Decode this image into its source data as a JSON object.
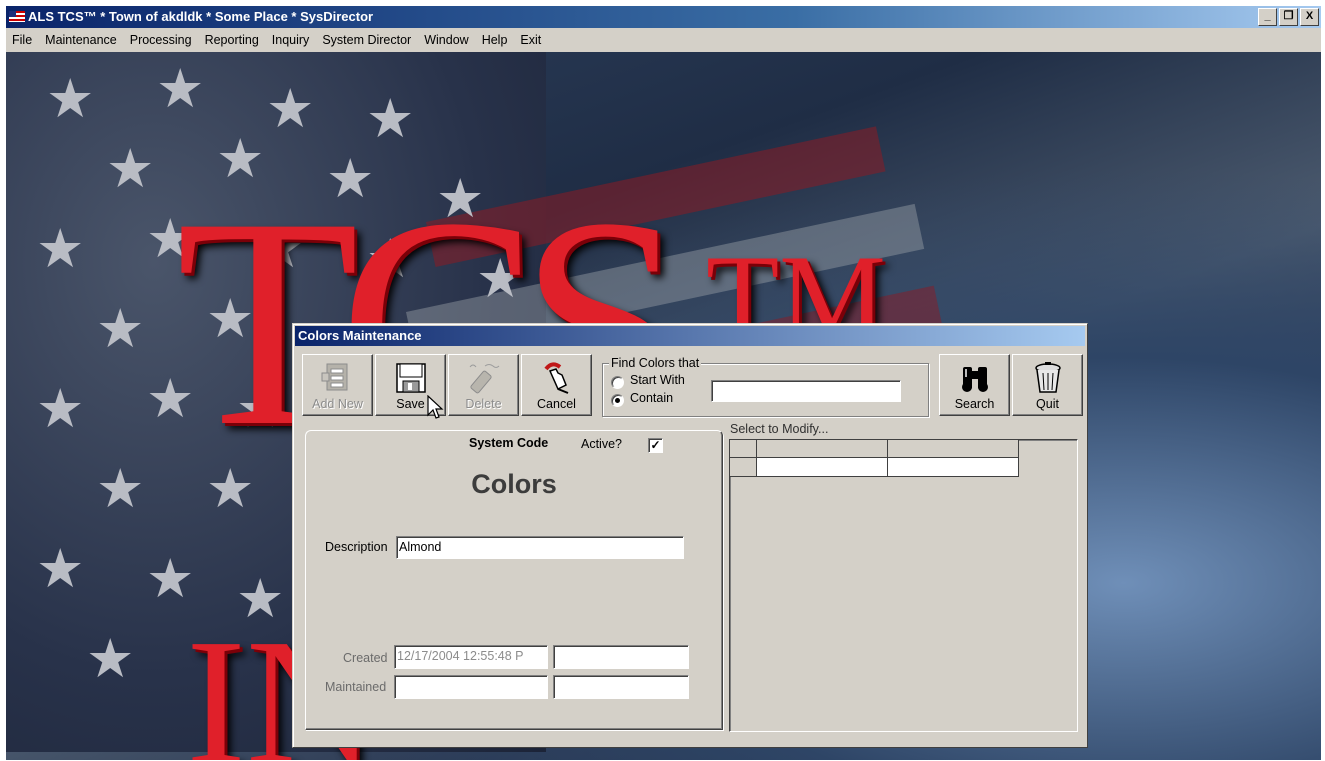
{
  "app": {
    "title": "ALS TCS™ * Town of akdldk * Some Place * SysDirector",
    "window_buttons": {
      "minimize": "_",
      "maximize": "B",
      "close": "X"
    }
  },
  "menu": [
    "File",
    "Maintenance",
    "Processing",
    "Reporting",
    "Inquiry",
    "System Director",
    "Window",
    "Help",
    "Exit"
  ],
  "background": {
    "brand_large": "TCS",
    "brand_tm": "TM",
    "brand_bottom": "IN"
  },
  "dialog": {
    "title": "Colors Maintenance",
    "toolbar": {
      "add_new": "Add New",
      "save": "Save",
      "delete": "Delete",
      "cancel": "Cancel",
      "search": "Search",
      "quit": "Quit"
    },
    "find": {
      "legend": "Find Colors that",
      "start_with": "Start With",
      "contain": "Contain",
      "selected": "Contain",
      "search_value": ""
    },
    "form": {
      "system_code_label": "System Code",
      "active_label": "Active?",
      "active_checked": true,
      "check_glyph": "✓",
      "heading": "Colors",
      "description_label": "Description",
      "description_value": "Almond",
      "created_label": "Created",
      "created_value": "12/17/2004 12:55:48 P",
      "created_by": "",
      "maintained_label": "Maintained",
      "maintained_value": "",
      "maintained_by": ""
    },
    "grid": {
      "caption": "Select to Modify..."
    }
  },
  "colors": {
    "titlebar_start": "#0a246a",
    "titlebar_end": "#a6caf0",
    "window_face": "#d4d0c8",
    "brand_red": "#e0202a"
  }
}
